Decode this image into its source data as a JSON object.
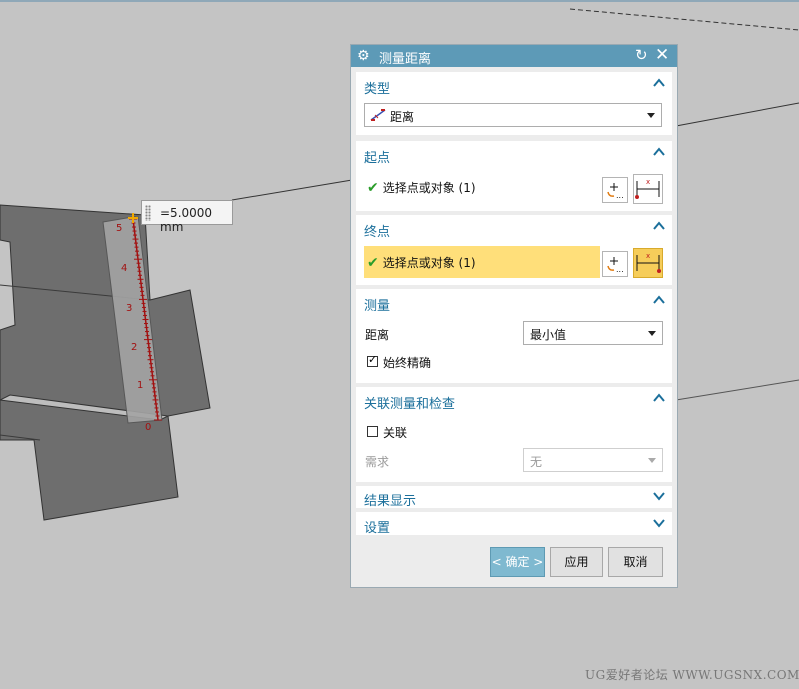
{
  "viewport": {
    "measure_label": "=5.0000 mm",
    "ruler_ticks": [
      "5",
      "4",
      "3",
      "2",
      "1",
      "0"
    ]
  },
  "watermark": "UG爱好者论坛 WWW.UGSNX.COM",
  "dialog": {
    "title": "测量距离",
    "sections": {
      "type": {
        "title": "类型",
        "select_value": "距离"
      },
      "start": {
        "title": "起点",
        "status": "选择点或对象 (1)"
      },
      "end": {
        "title": "终点",
        "status": "选择点或对象 (1)"
      },
      "measure": {
        "title": "测量",
        "distance_label": "距离",
        "distance_value": "最小值",
        "always_precise_label": "始终精确",
        "always_precise_checked": true
      },
      "associate": {
        "title": "关联测量和检查",
        "associate_label": "关联",
        "associate_checked": false,
        "requirement_label": "需求",
        "requirement_value": "无"
      },
      "results": {
        "title": "结果显示"
      },
      "settings": {
        "title": "设置"
      }
    },
    "buttons": {
      "ok": "< 确定 >",
      "apply": "应用",
      "cancel": "取消"
    }
  },
  "colors": {
    "titlebar": "#5d9ab7",
    "section_title": "#1b6f9b",
    "highlight": "#ffdf7a",
    "check_green": "#2a9d2a"
  }
}
